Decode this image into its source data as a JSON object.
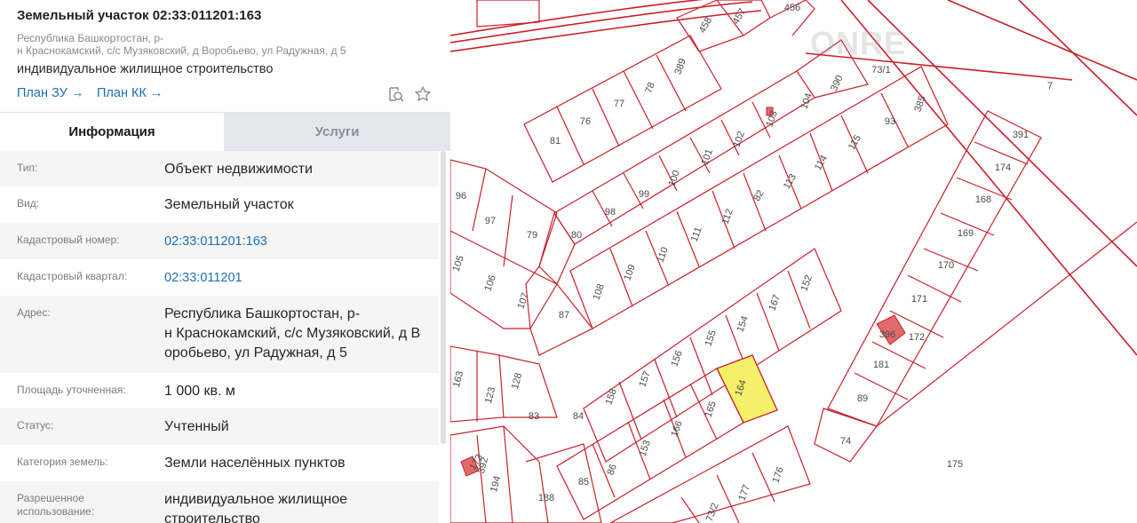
{
  "header": {
    "title": "Земельный участок 02:33:011201:163",
    "address_line1": "Республика Башкортостан, р-",
    "address_line2": "н Краснокамский, с/с Музяковский, д Воробьево, ул Радужная, д 5",
    "usage": "индивидуальное жилищное строительство",
    "link_zu": "План ЗУ →",
    "link_kk": "План КК →",
    "icons": [
      "search-map-icon",
      "star-icon"
    ]
  },
  "tabs": {
    "info": "Информация",
    "services": "Услуги"
  },
  "rows": {
    "r0": {
      "label": "Тип:",
      "value": "Объект недвижимости"
    },
    "r1": {
      "label": "Вид:",
      "value": "Земельный участок"
    },
    "r2": {
      "label": "Кадастровый номер:",
      "value": "02:33:011201:163"
    },
    "r3": {
      "label": "Кадастровый квартал:",
      "value": "02:33:011201"
    },
    "r4": {
      "label": "Адрес:",
      "value_l1": "Республика Башкортостан, р-",
      "value_l2": "н Краснокамский, с/с Музяковский, д В",
      "value_l3": "оробьево, ул Радужная, д 5"
    },
    "r5": {
      "label": "Площадь уточненная:",
      "value": "1 000 кв. м"
    },
    "r6": {
      "label": "Статус:",
      "value": "Учтенный"
    },
    "r7": {
      "label": "Категория земель:",
      "value": "Земли населённых пунктов"
    },
    "r8": {
      "label_l1": "Разрешенное",
      "label_l2": "использование:",
      "value_l1": "индивидуальное жилищное",
      "value_l2": "строительство"
    }
  },
  "map": {
    "watermark": "ONRE",
    "line_color": "#c8202a",
    "highlight_color": "#f5f06a",
    "plot_numbers": [
      "458",
      "457",
      "456",
      "389",
      "78",
      "77",
      "76",
      "81",
      "73/1",
      "390",
      "104",
      "103",
      "102",
      "101",
      "100",
      "99",
      "98",
      "80",
      "79",
      "97",
      "96",
      "7",
      "385",
      "93",
      "115",
      "114",
      "113",
      "82",
      "112",
      "111",
      "110",
      "109",
      "108",
      "87",
      "107",
      "106",
      "105",
      "391",
      "174",
      "168",
      "169",
      "170",
      "171",
      "396",
      "172",
      "152",
      "167",
      "154",
      "155",
      "156",
      "157",
      "158",
      "84",
      "83",
      "123",
      "128",
      "163",
      "164",
      "165",
      "166",
      "153",
      "86",
      "85",
      "188",
      "194",
      "392",
      "173",
      "181",
      "89",
      "74",
      "175",
      "176",
      "177",
      "73/2"
    ]
  }
}
